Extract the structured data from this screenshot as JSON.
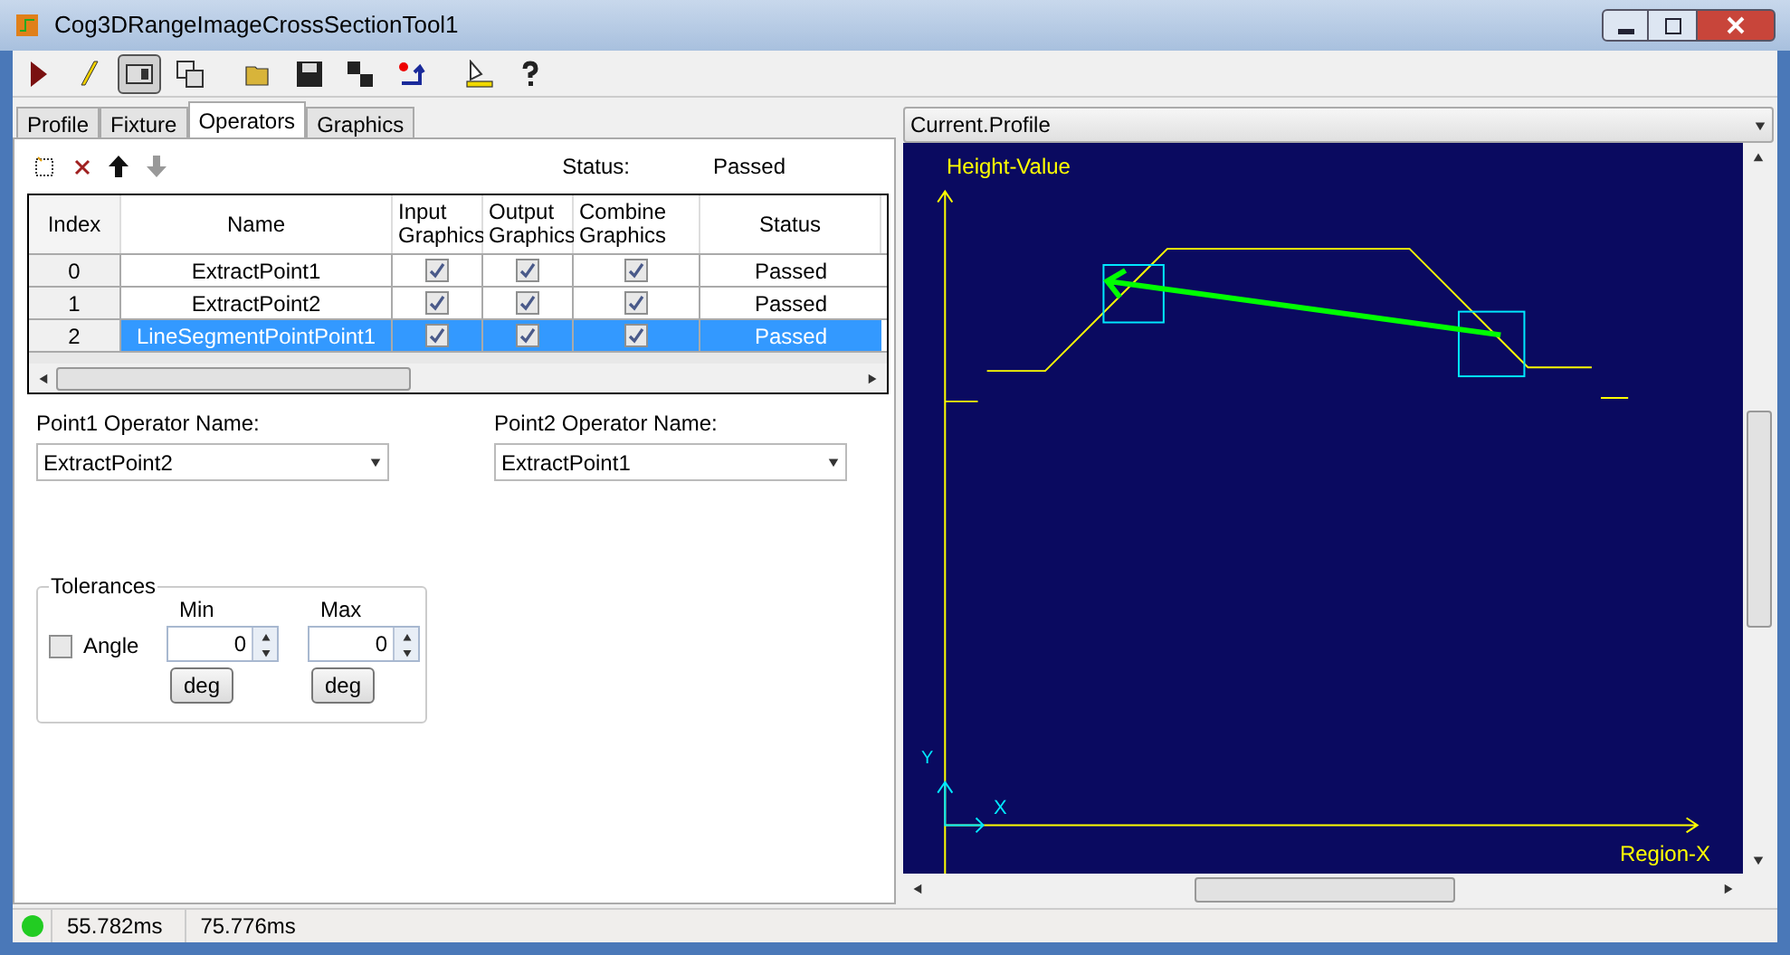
{
  "window": {
    "title": "Cog3DRangeImageCrossSectionTool1"
  },
  "toolbar_buttons": [
    {
      "pressed": false
    },
    {
      "pressed": false
    },
    {
      "pressed": true
    },
    {
      "pressed": false
    },
    {
      "pressed": false
    },
    {
      "pressed": false
    },
    {
      "pressed": false
    },
    {
      "pressed": false
    },
    {
      "pressed": false
    },
    {
      "pressed": false
    }
  ],
  "tabs": [
    {
      "label": "Profile",
      "selected": false
    },
    {
      "label": "Fixture",
      "selected": false
    },
    {
      "label": "Operators",
      "selected": true
    },
    {
      "label": "Graphics",
      "selected": false
    }
  ],
  "operators": {
    "status_label": "Status:",
    "status_value": "Passed"
  },
  "table": {
    "columns": [
      "Index",
      "Name",
      "Input Graphics",
      "Output Graphics",
      "Combine Graphics",
      "Status"
    ],
    "rows": [
      {
        "index": "0",
        "name": "ExtractPoint1",
        "input_graphics": true,
        "output_graphics": true,
        "combine_graphics": true,
        "status": "Passed",
        "selected": false
      },
      {
        "index": "1",
        "name": "ExtractPoint2",
        "input_graphics": true,
        "output_graphics": true,
        "combine_graphics": true,
        "status": "Passed",
        "selected": false
      },
      {
        "index": "2",
        "name": "LineSegmentPointPoint1",
        "input_graphics": true,
        "output_graphics": true,
        "combine_graphics": true,
        "status": "Passed",
        "selected": true
      }
    ]
  },
  "point1": {
    "label": "Point1 Operator Name:",
    "value": "ExtractPoint2"
  },
  "point2": {
    "label": "Point2 Operator Name:",
    "value": "ExtractPoint1"
  },
  "tolerances": {
    "title": "Tolerances",
    "min_label": "Min",
    "max_label": "Max",
    "angle": {
      "label": "Angle",
      "checked": false
    },
    "min_value": "0",
    "max_value": "0",
    "min_unit": "deg",
    "max_unit": "deg"
  },
  "profile_view": {
    "selector": "Current.Profile",
    "y_axis_label": "Height-Value",
    "x_axis_label": "Region-X",
    "x_mark": "X",
    "y_mark": "Y"
  },
  "status_bar": {
    "times": [
      "55.782ms",
      "75.776ms"
    ]
  }
}
